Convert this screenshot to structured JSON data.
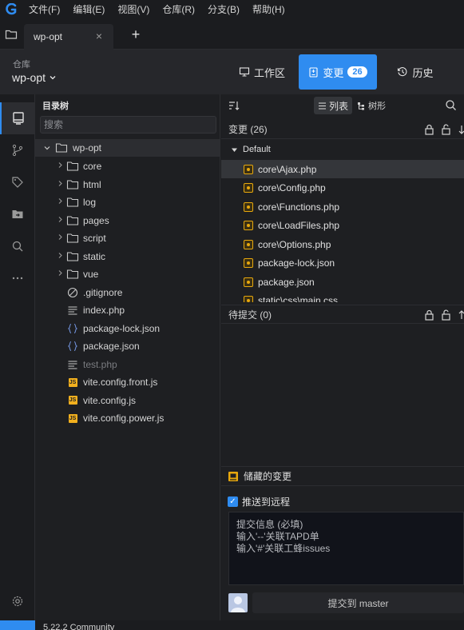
{
  "menu": {
    "items": [
      "文件(F)",
      "编辑(E)",
      "视图(V)",
      "仓库(R)",
      "分支(B)",
      "帮助(H)"
    ]
  },
  "tabs": {
    "active_title": "wp-opt",
    "close": "×",
    "add": "+"
  },
  "repo": {
    "label": "仓库",
    "name": "wp-opt"
  },
  "views": {
    "workspace": "工作区",
    "changes": "变更",
    "changes_count": "26",
    "history": "历史"
  },
  "tree": {
    "title": "目录树",
    "search_placeholder": "搜索",
    "root": "wp-opt",
    "folders": [
      "core",
      "html",
      "log",
      "pages",
      "script",
      "static",
      "vue"
    ],
    "files": [
      {
        "name": ".gitignore",
        "icon": "ignore-icon",
        "dim": false
      },
      {
        "name": "index.php",
        "icon": "lines-icon",
        "dim": false
      },
      {
        "name": "package-lock.json",
        "icon": "braces-icon",
        "dim": false
      },
      {
        "name": "package.json",
        "icon": "braces-icon",
        "dim": false
      },
      {
        "name": "test.php",
        "icon": "lines-icon",
        "dim": true
      },
      {
        "name": "vite.config.front.js",
        "icon": "js-icon",
        "dim": false
      },
      {
        "name": "vite.config.js",
        "icon": "js-icon",
        "dim": false
      },
      {
        "name": "vite.config.power.js",
        "icon": "js-icon",
        "dim": false
      }
    ]
  },
  "changes": {
    "mode_list": "列表",
    "mode_tree": "树形",
    "section_changes": "变更 (26)",
    "group": "Default",
    "files": [
      "core\\Ajax.php",
      "core\\Config.php",
      "core\\Functions.php",
      "core\\LoadFiles.php",
      "core\\Options.php",
      "package-lock.json",
      "package.json",
      "static\\css\\main.css"
    ],
    "section_pending": "待提交 (0)",
    "stash": "储藏的变更",
    "push_remote": "推送到远程",
    "commit_message": "提交信息 (必填)\n输入'--'关联TAPD单\n输入'#'关联工蜂issues",
    "commit_button": "提交到 master"
  },
  "status": {
    "version": "5.22.2 Community"
  },
  "colors": {
    "accent": "#2f8cf0",
    "modified": "#e8a80d",
    "js_badge": "#f2b01e"
  }
}
